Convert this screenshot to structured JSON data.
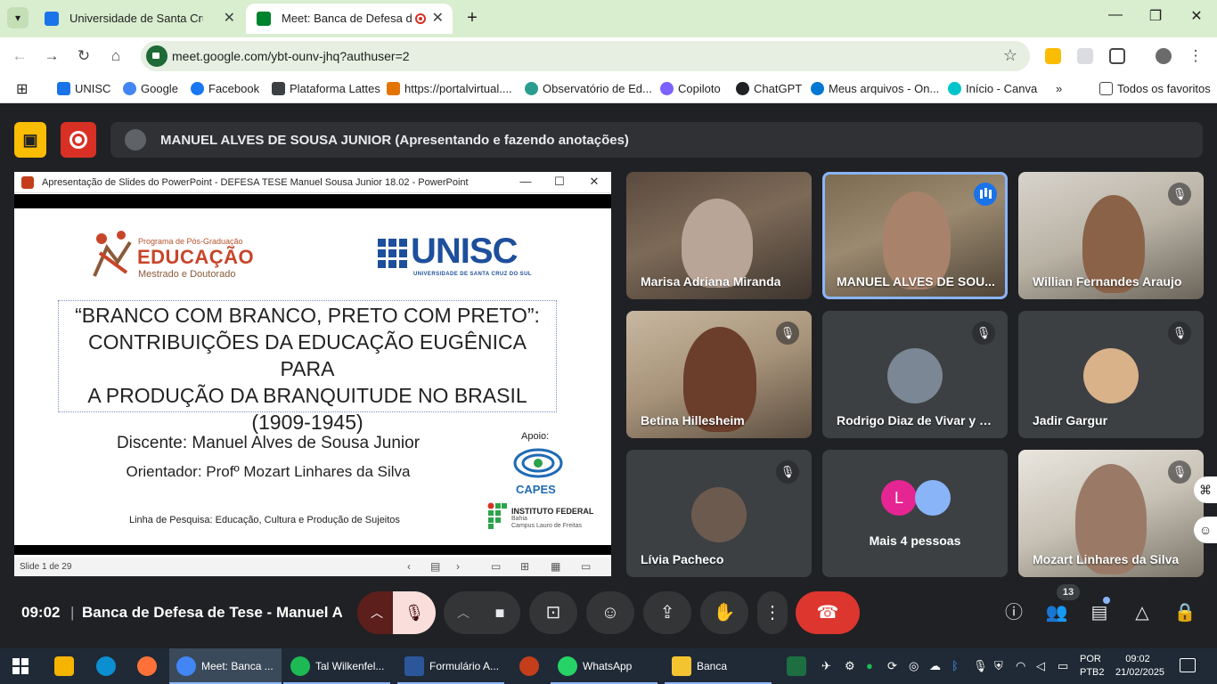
{
  "browser": {
    "tabs": [
      {
        "title": "Universidade de Santa Cruz do Sul",
        "active": false
      },
      {
        "title": "Meet: Banca de Defesa de Tese",
        "active": true
      }
    ],
    "url": "meet.google.com/ybt-ounv-jhq?authuser=2",
    "bookmarks": [
      {
        "label": "UNISC",
        "icon": "grid-icon",
        "color": "#1a73e8"
      },
      {
        "label": "Google",
        "icon": "google-icon",
        "color": "#4285f4"
      },
      {
        "label": "Facebook",
        "icon": "facebook-icon",
        "color": "#1877f2"
      },
      {
        "label": "Plataforma Lattes",
        "icon": "lattes-icon",
        "color": "#3c4043"
      },
      {
        "label": "https://portalvirtual....",
        "icon": "portal-icon",
        "color": "#e37400"
      },
      {
        "label": "Observatório de Ed...",
        "icon": "globe-icon",
        "color": "#2a9d8f"
      },
      {
        "label": "Copiloto",
        "icon": "copilot-icon",
        "color": "#7b61ff"
      },
      {
        "label": "ChatGPT",
        "icon": "chatgpt-icon",
        "color": "#202124"
      },
      {
        "label": "Meus arquivos - On...",
        "icon": "onedrive-icon",
        "color": "#0078d4"
      },
      {
        "label": "Início - Canva",
        "icon": "canva-icon",
        "color": "#00c4cc"
      }
    ],
    "all_bookmarks": "Todos os favoritos"
  },
  "meet": {
    "presenter_text": "MANUEL ALVES DE SOUSA JUNIOR (Apresentando e fazendo anotações)",
    "clock": "09:02",
    "separator": "|",
    "meeting_name": "Banca de Defesa de Tese - Manuel Al...",
    "people_count": "13",
    "participants": [
      {
        "name": "Marisa Adriana Miranda",
        "muted": false,
        "video": true
      },
      {
        "name": "MANUEL ALVES DE SOU...",
        "muted": false,
        "video": true,
        "speaking": true
      },
      {
        "name": "Willian Fernandes Araujo",
        "muted": true,
        "video": true
      },
      {
        "name": "Betina Hillesheim",
        "muted": true,
        "video": true
      },
      {
        "name": "Rodrigo Diaz de Vivar y S...",
        "muted": true,
        "video": false
      },
      {
        "name": "Jadir Gargur",
        "muted": true,
        "video": false
      },
      {
        "name": "Lívia Pacheco",
        "muted": true,
        "video": false
      },
      {
        "name": "Mozart Linhares da Silva",
        "muted": true,
        "video": true
      }
    ],
    "more_people": {
      "initial": "L",
      "label": "Mais 4 pessoas"
    }
  },
  "ppt": {
    "window_title": "Apresentação de Slides do PowerPoint  -  DEFESA TESE Manuel Sousa Junior 18.02 - PowerPoint",
    "status": "Slide 1 de 29",
    "slide": {
      "program_small": "Programa de Pós-Graduação",
      "program_big": "EDUCAÇÃO",
      "program_sub": "Mestrado e Doutorado",
      "unisc": "UNISC",
      "unisc_sub": "UNIVERSIDADE DE SANTA CRUZ DO SUL",
      "title_lines": [
        "“BRANCO COM BRANCO, PRETO COM PRETO”:",
        "CONTRIBUIÇÕES DA EDUCAÇÃO EUGÊNICA PARA",
        "A PRODUÇÃO DA BRANQUITUDE NO BRASIL",
        "(1909-1945)"
      ],
      "discente": "Discente: Manuel Alves de Sousa Junior",
      "orientador": "Orientador: Profº Mozart Linhares da Silva",
      "linha": "Linha de Pesquisa: Educação, Cultura e Produção de Sujeitos",
      "apoio": "Apoio:",
      "capes": "CAPES",
      "if_name": "INSTITUTO FEDERAL",
      "if_sub1": "Bahia",
      "if_sub2": "Campus Lauro de Freitas"
    }
  },
  "taskbar": {
    "apps": [
      {
        "label": "Meet: Banca ...",
        "color": "#4285f4",
        "active": true
      },
      {
        "label": "Tal Wilkenfel...",
        "color": "#1db954",
        "active": false
      },
      {
        "label": "Formulário A...",
        "color": "#2b579a",
        "active": false
      },
      {
        "label": "WhatsApp",
        "color": "#25d366",
        "active": false
      },
      {
        "label": "Banca",
        "color": "#f4c430",
        "active": false
      }
    ],
    "lang1": "POR",
    "lang2": "PTB2",
    "time": "09:02",
    "date": "21/02/2025"
  }
}
